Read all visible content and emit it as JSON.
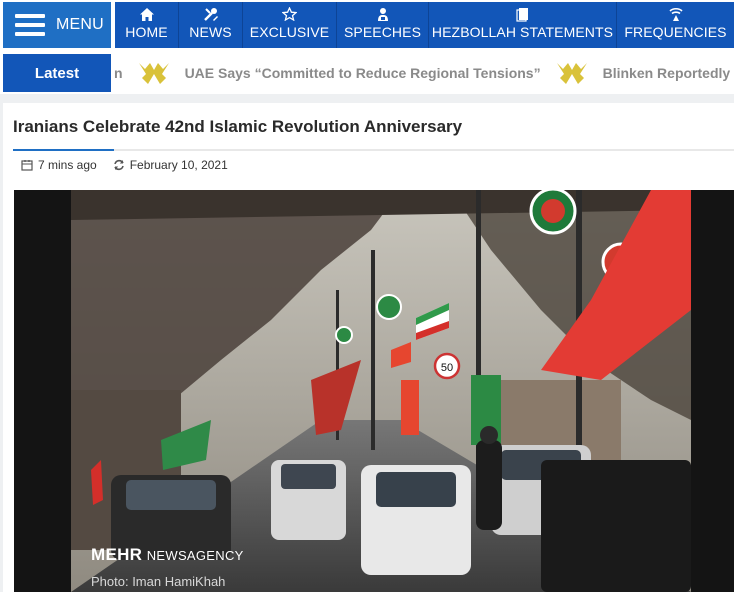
{
  "header": {
    "menu_label": "MENU",
    "nav": [
      {
        "label": "HOME",
        "icon": "home-icon"
      },
      {
        "label": "NEWS",
        "icon": "tools-icon"
      },
      {
        "label": "EXCLUSIVE",
        "icon": "star-icon"
      },
      {
        "label": "SPEECHES",
        "icon": "speaker-icon"
      },
      {
        "label": "HEZBOLLAH STATEMENTS",
        "icon": "document-icon"
      },
      {
        "label": "FREQUENCIES",
        "icon": "satellite-icon"
      }
    ]
  },
  "ticker": {
    "label": "Latest",
    "items": [
      "n",
      "UAE Says “Committed to Reduce Regional Tensions”",
      "Blinken Reportedly"
    ]
  },
  "article": {
    "title": "Iranians Celebrate 42nd Islamic Revolution Anniversary",
    "time_ago": "7 mins ago",
    "date": "February 10, 2021",
    "image_brand": "MEHR",
    "image_brand_suffix": "NEWSAGENCY",
    "image_credit": "Photo: Iman HamiKhah"
  },
  "colors": {
    "nav_blue": "#1256b8",
    "menu_blue": "#1f6fc4",
    "logo_gold": "#d9c23a"
  }
}
